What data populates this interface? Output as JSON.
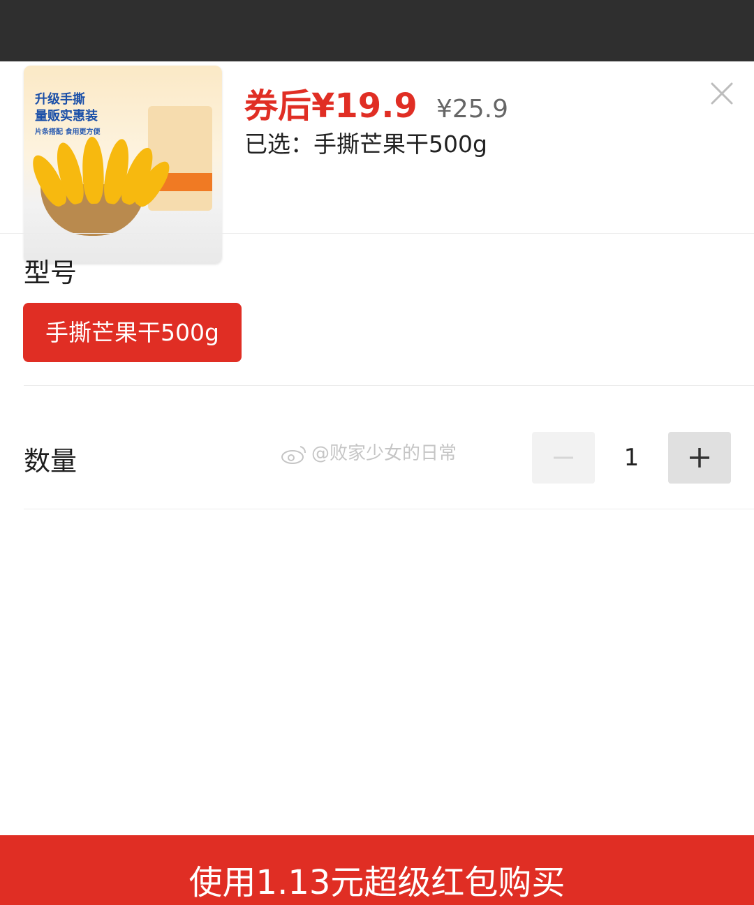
{
  "overlay": {
    "color": "#2f2f2f"
  },
  "product": {
    "image_alt": "升级手撕量贩实惠装芒果干",
    "image_text": {
      "line1": "升级手撕",
      "line2": "量贩实惠装",
      "line3": "片条搭配 食用更方便"
    },
    "price_after_coupon": "券后¥19.9",
    "original_price": "¥25.9",
    "selected_text": "已选：手撕芒果干500g"
  },
  "close_icon": "close-icon",
  "variant_section": {
    "title": "型号",
    "options": [
      {
        "label": "手撕芒果干500g",
        "selected": true
      }
    ]
  },
  "quantity_section": {
    "title": "数量",
    "value": "1",
    "minus_icon": "minus-icon",
    "plus_icon": "plus-icon"
  },
  "watermark": {
    "text": "@败家少女的日常",
    "icon": "weibo-icon"
  },
  "buy_button": {
    "label": "使用1.13元超级红包购买"
  },
  "colors": {
    "accent": "#e02e24",
    "original_price": "#666666",
    "text": "#222222"
  }
}
